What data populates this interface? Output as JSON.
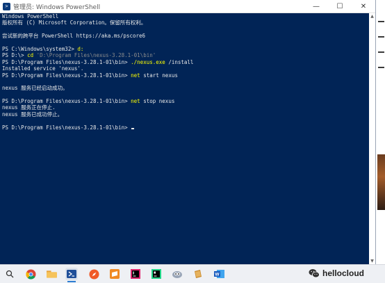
{
  "window": {
    "title": "管理员: Windows PowerShell",
    "icon": "powershell-icon",
    "buttons": {
      "minimize": "—",
      "maximize": "☐",
      "close": "✕"
    },
    "background_color": "#012456"
  },
  "terminal": {
    "lines": [
      {
        "segments": [
          {
            "text": "Windows PowerShell",
            "style": "normal"
          }
        ]
      },
      {
        "segments": [
          {
            "text": "版权所有 (C) Microsoft Corporation。保留所有权利。",
            "style": "normal"
          }
        ]
      },
      {
        "segments": [
          {
            "text": "",
            "style": "normal"
          }
        ]
      },
      {
        "segments": [
          {
            "text": "尝试新的跨平台 PowerShell https://aka.ms/pscore6",
            "style": "normal"
          }
        ]
      },
      {
        "segments": [
          {
            "text": "",
            "style": "normal"
          }
        ]
      },
      {
        "segments": [
          {
            "text": "PS C:\\Windows\\system32> ",
            "style": "normal"
          },
          {
            "text": "d:",
            "style": "cmd"
          }
        ]
      },
      {
        "segments": [
          {
            "text": "PS D:\\> ",
            "style": "normal"
          },
          {
            "text": "cd ",
            "style": "cmd"
          },
          {
            "text": "'D:\\Program Files\\nexus-3.28.1-01\\bin'",
            "style": "dim"
          }
        ]
      },
      {
        "segments": [
          {
            "text": "PS D:\\Program Files\\nexus-3.28.1-01\\bin> ",
            "style": "normal"
          },
          {
            "text": "./nexus.exe ",
            "style": "cmd"
          },
          {
            "text": "/install",
            "style": "normal"
          }
        ]
      },
      {
        "segments": [
          {
            "text": "Installed service 'nexus'.",
            "style": "normal"
          }
        ]
      },
      {
        "segments": [
          {
            "text": "PS D:\\Program Files\\nexus-3.28.1-01\\bin> ",
            "style": "normal"
          },
          {
            "text": "net ",
            "style": "cmd"
          },
          {
            "text": "start nexus",
            "style": "normal"
          }
        ]
      },
      {
        "segments": [
          {
            "text": "",
            "style": "normal"
          }
        ]
      },
      {
        "segments": [
          {
            "text": "nexus 服务已经启动成功。",
            "style": "normal"
          }
        ]
      },
      {
        "segments": [
          {
            "text": "",
            "style": "normal"
          }
        ]
      },
      {
        "segments": [
          {
            "text": "PS D:\\Program Files\\nexus-3.28.1-01\\bin> ",
            "style": "normal"
          },
          {
            "text": "net ",
            "style": "cmd"
          },
          {
            "text": "stop nexus",
            "style": "normal"
          }
        ]
      },
      {
        "segments": [
          {
            "text": "nexus 服务正在停止.",
            "style": "normal"
          }
        ]
      },
      {
        "segments": [
          {
            "text": "nexus 服务已成功停止。",
            "style": "normal"
          }
        ]
      },
      {
        "segments": [
          {
            "text": "",
            "style": "normal"
          }
        ]
      },
      {
        "segments": [
          {
            "text": "PS D:\\Program Files\\nexus-3.28.1-01\\bin> ",
            "style": "normal"
          }
        ],
        "cursor": true
      }
    ],
    "colors": {
      "normal": "#e8e8e8",
      "cmd": "#ffff00",
      "dim": "#8c8c8c"
    }
  },
  "taskbar": {
    "items": [
      {
        "name": "search-icon",
        "active": false
      },
      {
        "name": "chrome-icon",
        "active": false
      },
      {
        "name": "file-explorer-icon",
        "active": false
      },
      {
        "name": "powershell-icon",
        "active": true
      },
      {
        "name": "safari-icon",
        "active": false
      },
      {
        "name": "sublime-text-icon",
        "active": false
      },
      {
        "name": "intellij-idea-icon",
        "active": false
      },
      {
        "name": "pycharm-icon",
        "active": false
      },
      {
        "name": "navicat-icon",
        "active": false
      },
      {
        "name": "notebook-icon",
        "active": false
      },
      {
        "name": "word-icon",
        "active": false
      }
    ]
  },
  "watermark": {
    "text": "hellocloud",
    "icon": "wechat-icon"
  }
}
